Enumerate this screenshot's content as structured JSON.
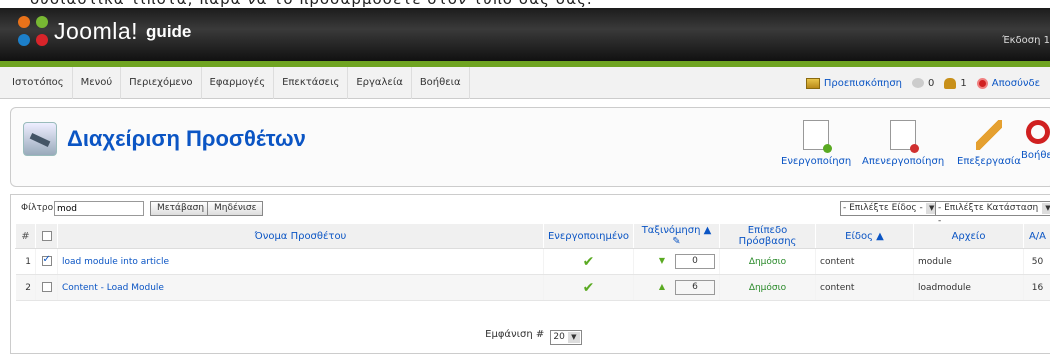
{
  "top_clip_text": "ουσιαστικά τίποτα, παρά να το προσαρμόσετε στον τύπο σας σας.",
  "header": {
    "logo_text": "Joomla!",
    "logo_suffix": "guide",
    "version": "Έκδοση 1"
  },
  "menu": [
    "Ιστοτόπος",
    "Μενού",
    "Περιεχόμενο",
    "Εφαρμογές",
    "Επεκτάσεις",
    "Εργαλεία",
    "Βοήθεια"
  ],
  "status": {
    "preview": "Προεπισκόπηση",
    "messages": "0",
    "users": "1",
    "logout": "Αποσύνδε"
  },
  "page_title": "Διαχείριση Προσθέτων",
  "toolbar": {
    "enable": "Ενεργοποίηση",
    "disable": "Απενεργοποίηση",
    "edit": "Επεξεργασία",
    "help": "Βοήθει"
  },
  "filter": {
    "label": "Φίλτρο:",
    "value": "mod",
    "go": "Μετάβαση",
    "reset": "Μηδένισε",
    "type_select": "- Επιλέξτε Είδος -",
    "state_select": "- Επιλέξτε Κατάσταση -"
  },
  "columns": {
    "num": "#",
    "name": "Όνομα Προσθέτου",
    "enabled": "Ενεργοποιημένο",
    "order": "Ταξινόμηση",
    "access": "Επίπεδο Πρόσβασης",
    "type": "Είδος",
    "file": "Αρχείο",
    "id": "Α/Α"
  },
  "rows": [
    {
      "num": "1",
      "checked": true,
      "name": "load module into article",
      "order": "0",
      "access": "Δημόσιο",
      "type": "content",
      "file": "module",
      "id": "50"
    },
    {
      "num": "2",
      "checked": false,
      "name": "Content - Load Module",
      "order": "6",
      "access": "Δημόσιο",
      "type": "content",
      "file": "loadmodule",
      "id": "16"
    }
  ],
  "footer": {
    "label": "Εμφάνιση #",
    "value": "20"
  }
}
